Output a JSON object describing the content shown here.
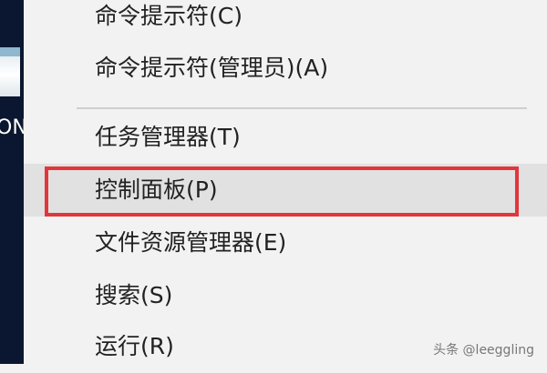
{
  "desktop": {
    "label_fragment": "ON"
  },
  "menu": {
    "items": [
      {
        "label": "命令提示符(C)"
      },
      {
        "label": "命令提示符(管理员)(A)"
      },
      {
        "label": "任务管理器(T)"
      },
      {
        "label": "控制面板(P)",
        "state": "hovered"
      },
      {
        "label": "文件资源管理器(E)"
      },
      {
        "label": "搜索(S)"
      },
      {
        "label": "运行(R)"
      }
    ]
  },
  "annotation": {
    "highlight_color": "#e1363b"
  },
  "watermark": {
    "text": "头条 @leeggling"
  }
}
